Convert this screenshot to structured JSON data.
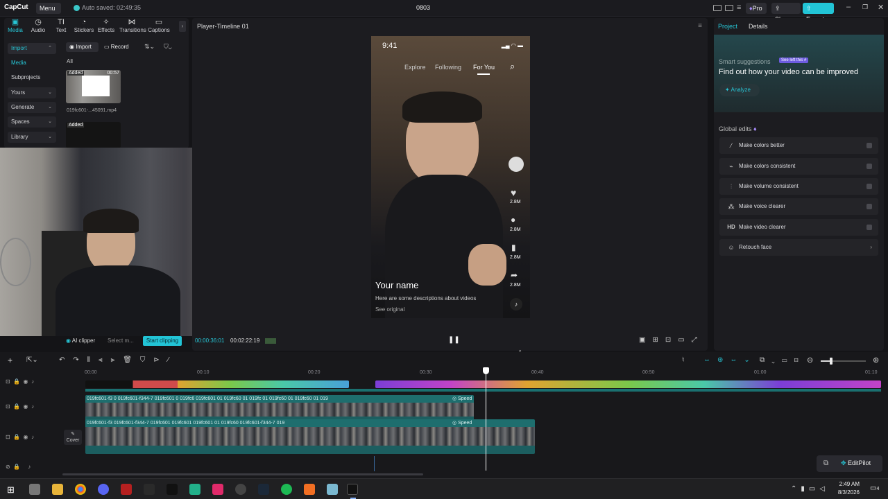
{
  "topbar": {
    "logo": "CapCut",
    "menu": "Menu",
    "autosave": "Auto saved: 02:49:35",
    "title": "0803",
    "pro": "Pro",
    "share": "Share",
    "export": "Export"
  },
  "media_tabs": [
    {
      "label": "Media",
      "icon": "media-icon"
    },
    {
      "label": "Audio",
      "icon": "audio-icon"
    },
    {
      "label": "Text",
      "icon": "text-icon"
    },
    {
      "label": "Stickers",
      "icon": "stickers-icon"
    },
    {
      "label": "Effects",
      "icon": "effects-icon"
    },
    {
      "label": "Transitions",
      "icon": "transitions-icon"
    },
    {
      "label": "Captions",
      "icon": "captions-icon"
    }
  ],
  "sidenav": {
    "import": "Import",
    "media": "Media",
    "subprojects": "Subprojects",
    "yours": "Yours",
    "generate": "Generate",
    "spaces": "Spaces",
    "library": "Library"
  },
  "media_toolbar": {
    "import": "Import",
    "record": "Record",
    "filter_all": "All"
  },
  "media_items": [
    {
      "badge": "Added",
      "duration": "00:57",
      "name": "019fc601-...45091.mp4"
    },
    {
      "badge": "Added",
      "duration": "",
      "name": ""
    }
  ],
  "player": {
    "title": "Player-Timeline 01",
    "current_time": "00:00:36:01",
    "total_time": "00:02:22:19",
    "ai_clipper": "AI clipper",
    "select_placeholder": "Select m...",
    "start_clipping": "Start clipping"
  },
  "phone": {
    "time": "9:41",
    "tabs": [
      "Explore",
      "Following",
      "For You"
    ],
    "counts": [
      "2.8M",
      "2.8M",
      "2.8M",
      "2.8M"
    ],
    "name": "Your name",
    "description": "Here are some descriptions about videos",
    "see_original": "See original"
  },
  "right_panel": {
    "tab_project": "Project",
    "tab_details": "Details",
    "smart_title": "Smart suggestions",
    "smart_badge": "See left this #",
    "smart_heading": "Find out how your video can be improved",
    "analyze": "Analyze",
    "global_edits": "Global edits",
    "edits": [
      {
        "label": "Make colors better",
        "icon": "magic-wand-icon"
      },
      {
        "label": "Make colors consistent",
        "icon": "color-brush-icon"
      },
      {
        "label": "Make volume consistent",
        "icon": "sliders-icon"
      },
      {
        "label": "Make voice clearer",
        "icon": "voice-sparkle-icon"
      },
      {
        "label": "Make video clearer",
        "icon": "hd-icon",
        "glyph": "HD"
      },
      {
        "label": "Retouch face",
        "icon": "face-icon"
      }
    ]
  },
  "timeline": {
    "ruler": [
      "00:00",
      "00:10",
      "00:20",
      "00:30",
      "00:40",
      "00:50",
      "01:00",
      "01:10"
    ],
    "clip_label_1": "019fc601-f3 0 019fc601-f344-7 019fc601 0 019fc6 019fc601 01 019fc60 01 019fc 01 019fc60 01 019fc60 01 019",
    "clip_label_1b": "Speed",
    "clip_label_2": "019fc601-f3 019fc601-f344-7 019fc601 019fc601 019fc601 01 019fc60 019fc601-f344-7 019",
    "clip_label_2b": "Speed",
    "cover": "Cover",
    "editpilot": "EditPilot"
  },
  "taskbar": {
    "time": "2:49 AM",
    "date": "8/3/2026",
    "notif": "4"
  },
  "colors": {
    "accent": "#27c6d6",
    "export_bg": "#22c4d6",
    "clip_teal": "#1e6e6e"
  }
}
